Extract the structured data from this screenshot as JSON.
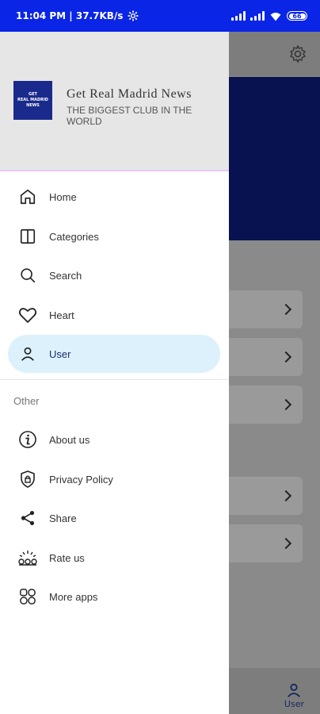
{
  "status_bar": {
    "time_speed": "11:04 PM | 37.7KB/s",
    "battery": "66"
  },
  "header": {
    "logo_lines": [
      "GET",
      "REAL MADRID",
      "NEWS"
    ],
    "title": "Get Real Madrid News",
    "subtitle": "THE BIGGEST CLUB IN THE WORLD"
  },
  "menu": {
    "items": [
      {
        "label": "Home",
        "icon": "home-icon"
      },
      {
        "label": "Categories",
        "icon": "categories-icon"
      },
      {
        "label": "Search",
        "icon": "search-icon"
      },
      {
        "label": "Heart",
        "icon": "heart-icon"
      },
      {
        "label": "User",
        "icon": "user-icon",
        "active": true
      }
    ],
    "section_label": "Other",
    "other_items": [
      {
        "label": "About us",
        "icon": "info-icon"
      },
      {
        "label": "Privacy Policy",
        "icon": "shield-lock-icon"
      },
      {
        "label": "Share",
        "icon": "share-icon"
      },
      {
        "label": "Rate us",
        "icon": "rate-icon"
      },
      {
        "label": "More apps",
        "icon": "apps-icon"
      }
    ]
  },
  "background": {
    "bottom_nav_user_label": "User"
  },
  "colors": {
    "status_bar": "#0a25e6",
    "active_item_bg": "#dcf1fc",
    "banner": "#081250"
  }
}
